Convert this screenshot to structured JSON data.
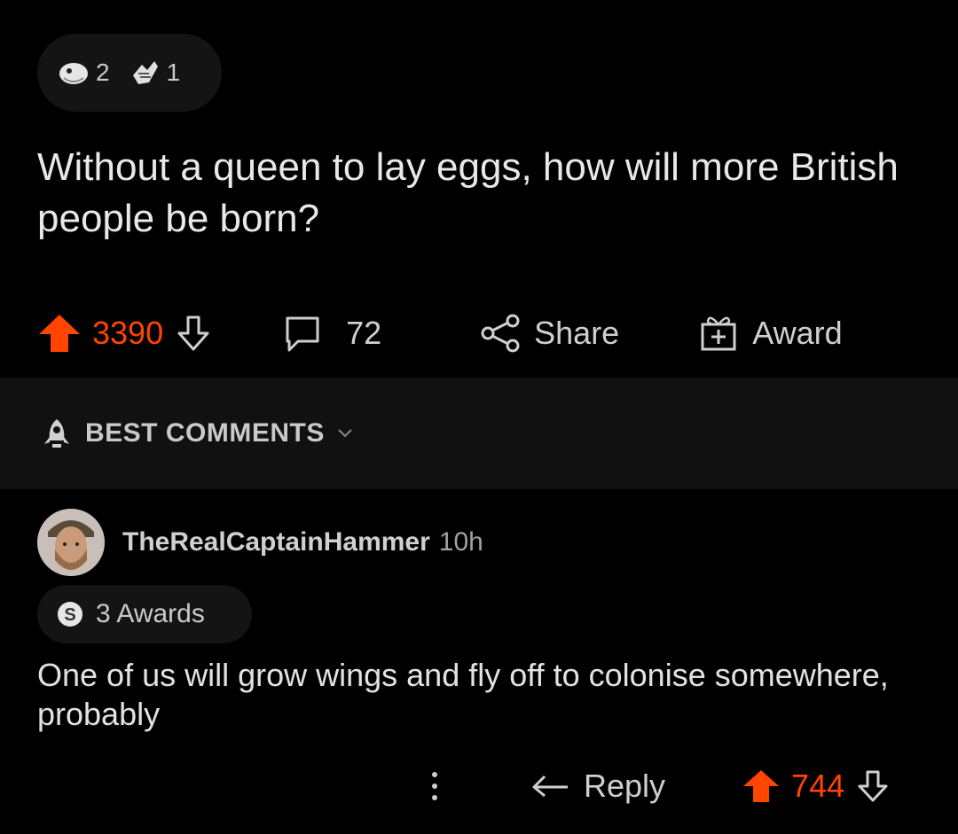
{
  "post": {
    "awards": [
      {
        "icon": "silver-award-icon",
        "count": "2"
      },
      {
        "icon": "wholesome-hands-icon",
        "count": "1"
      }
    ],
    "title": "Without a queen to lay eggs, how will more British people be born?",
    "votes": "3390",
    "comments": "72",
    "share_label": "Share",
    "award_label": "Award"
  },
  "sort": {
    "label": "BEST COMMENTS"
  },
  "comment": {
    "username": "TheRealCaptainHammer",
    "age": "10h",
    "awards_label": "3 Awards",
    "body": "One of us will grow wings and fly off to colonise somewhere, probably",
    "reply_label": "Reply",
    "votes": "744"
  },
  "colors": {
    "accent": "#ff4500",
    "background": "#000000",
    "bar": "#111111"
  }
}
